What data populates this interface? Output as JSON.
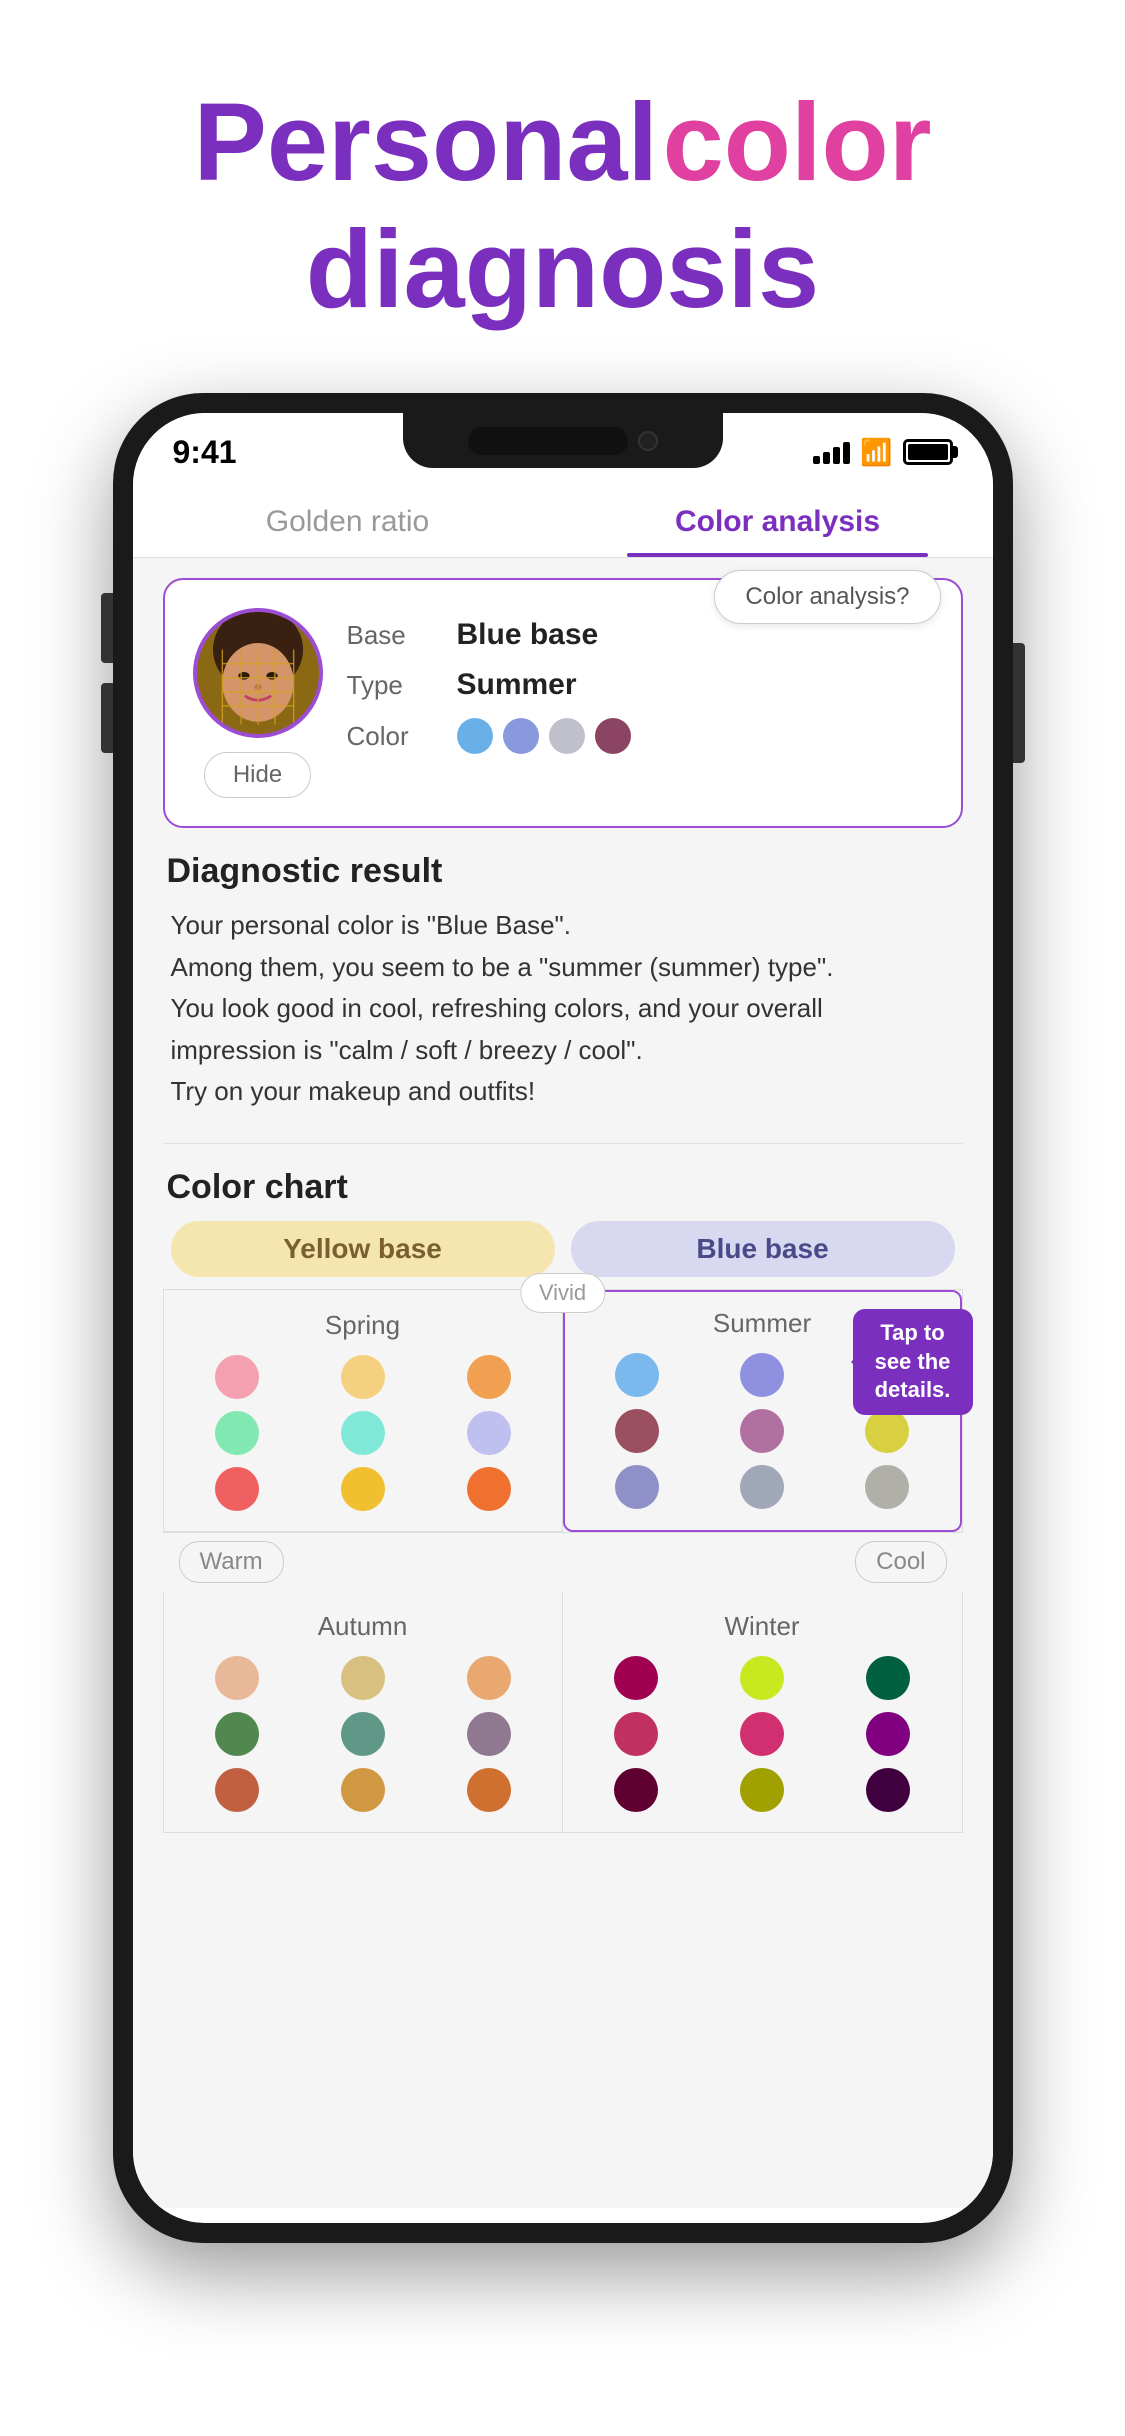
{
  "hero": {
    "word1": "Personal",
    "word2": "color",
    "word3": "diagnosis"
  },
  "statusBar": {
    "time": "9:41",
    "batteryFull": true
  },
  "tabs": [
    {
      "id": "golden",
      "label": "Golden ratio",
      "active": false
    },
    {
      "id": "color",
      "label": "Color analysis",
      "active": true
    }
  ],
  "profileCard": {
    "base_label": "Base",
    "base_value": "Blue base",
    "type_label": "Type",
    "type_value": "Summer",
    "color_label": "Color",
    "colors": [
      {
        "hex": "#6ab0e8",
        "name": "light-blue"
      },
      {
        "hex": "#8899dd",
        "name": "periwinkle"
      },
      {
        "hex": "#c0c0cc",
        "name": "silver-grey"
      },
      {
        "hex": "#8B4562",
        "name": "dusty-rose"
      }
    ],
    "hideBtn": "Hide"
  },
  "colorAnalysisBtn": "Color analysis?",
  "diagnostic": {
    "title": "Diagnostic result",
    "text": "Your personal color is \"Blue Base\".\nAmong them, you seem to be a \"summer (summer) type\".\nYou look good in cool, refreshing colors, and your overall impression is \"calm / soft / breezy / cool\".\nTry on your makeup and outfits!"
  },
  "colorChart": {
    "title": "Color chart",
    "yellowBase": "Yellow base",
    "blueBase": "Blue base",
    "vivid": "Vivid",
    "warm": "Warm",
    "cool": "Cool",
    "tapTooltip": "Tap to see the details.",
    "spring": {
      "name": "Spring",
      "dots": [
        "#f4a0b0",
        "#f5d080",
        "#f0a050",
        "#80e8b0",
        "#80e8d8",
        "#c0c0f0",
        "#f06060",
        "#f0c030",
        "#f07030"
      ]
    },
    "summer": {
      "name": "Summer",
      "dots": [
        "#7ab8ee",
        "#9090e0",
        "#b0b0c0",
        "#9a5060",
        "#b070a0",
        "#d8d040",
        "#9090c8",
        "#a0a0b8",
        "#b0b0a8"
      ]
    },
    "autumn": {
      "name": "Autumn",
      "dots": [
        "#e8b898",
        "#d8c080",
        "#e8a870",
        "#508850",
        "#609888",
        "#907890",
        "#c06040",
        "#d09840",
        "#d07030"
      ]
    },
    "winter": {
      "name": "Winter",
      "dots": [
        "#a00050",
        "#c8e820",
        "#006040",
        "#c03060",
        "#d03070",
        "#800080",
        "#600030",
        "#a0a000",
        "#400040"
      ]
    }
  }
}
